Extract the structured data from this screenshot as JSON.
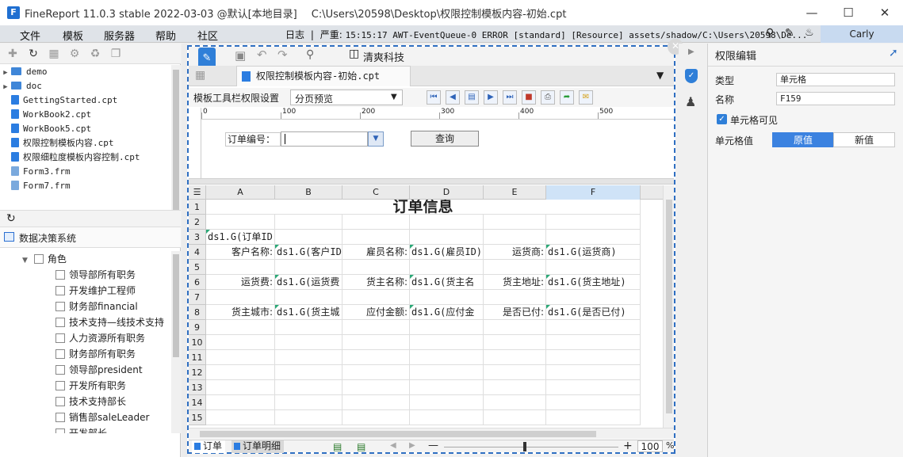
{
  "window": {
    "app_title": "FineReport 11.0.3 stable 2022-03-03 @默认[本地目录]",
    "file_path": "C:\\Users\\20598\\Desktop\\权限控制模板内容-初始.cpt"
  },
  "menu": [
    "文件",
    "模板",
    "服务器",
    "帮助",
    "社区"
  ],
  "log": {
    "label": "日志",
    "severity": "严重",
    "message": "15:15:17 AWT-EventQueue-0 ERROR [standard] [Resource] assets/shadow/C:\\Users\\20598\\De..."
  },
  "user": "Carly",
  "file_tree": [
    {
      "type": "folder",
      "name": "demo"
    },
    {
      "type": "folder",
      "name": "doc"
    },
    {
      "type": "cpt",
      "name": "GettingStarted.cpt"
    },
    {
      "type": "cpt",
      "name": "WorkBook2.cpt"
    },
    {
      "type": "cpt",
      "name": "WorkBook5.cpt"
    },
    {
      "type": "cpt",
      "name": "权限控制模板内容.cpt"
    },
    {
      "type": "cpt",
      "name": "权限细粒度模板内容控制.cpt"
    },
    {
      "type": "frm",
      "name": "Form3.frm"
    },
    {
      "type": "frm",
      "name": "Form7.frm"
    }
  ],
  "system_title": "数据决策系统",
  "role_root": "角色",
  "roles": [
    "领导部所有职务",
    "开发维护工程师",
    "财务部financial",
    "技术支持—线技术支持",
    "人力资源所有职务",
    "财务部所有职务",
    "领导部president",
    "开发所有职务",
    "技术支持部长",
    "销售部saleLeader",
    "开发部长"
  ],
  "editor": {
    "toolbar_company": "清爽科技",
    "tab_title": "权限控制模板内容-初始.cpt",
    "param_label": "模板工具栏权限设置",
    "preview_mode": "分页预览",
    "ruler_marks": [
      "0",
      "100",
      "200",
      "300",
      "400",
      "500"
    ],
    "param_field_label": "订单编号：",
    "query_button": "查询"
  },
  "grid": {
    "columns": [
      "A",
      "B",
      "C",
      "D",
      "E",
      "F"
    ],
    "rows": [
      "1",
      "2",
      "3",
      "4",
      "5",
      "6",
      "7",
      "8",
      "9",
      "10",
      "11",
      "12",
      "13",
      "14",
      "15"
    ],
    "title": "订单信息",
    "cells": {
      "a3": "ds1.G(订单ID",
      "a4": "客户名称:",
      "b4": "ds1.G(客户ID",
      "c4": "雇员名称:",
      "d4": "ds1.G(雇员ID)",
      "e4": "运货商:",
      "f4": "ds1.G(运货商)",
      "a6": "运货费:",
      "b6": "ds1.G(运货费",
      "c6": "货主名称:",
      "d6": "ds1.G(货主名",
      "e6": "货主地址:",
      "f6": "ds1.G(货主地址)",
      "a8": "货主城市:",
      "b8": "ds1.G(货主城",
      "c8": "应付金额:",
      "d8": "ds1.G(应付金",
      "e8": "是否已付:",
      "f8": "ds1.G(是否已付)"
    }
  },
  "sheets": [
    "订单",
    "订单明细"
  ],
  "zoom": "100",
  "zoom_unit": "%",
  "right_panel": {
    "title": "权限编辑",
    "type_label": "类型",
    "type_value": "单元格",
    "name_label": "名称",
    "name_value": "F159",
    "visible_label": "单元格可见",
    "value_label": "单元格值",
    "seg_original": "原值",
    "seg_new": "新值"
  },
  "colors": {
    "accent": "#2f6fc2",
    "selected_seg": "#3b82e0"
  }
}
